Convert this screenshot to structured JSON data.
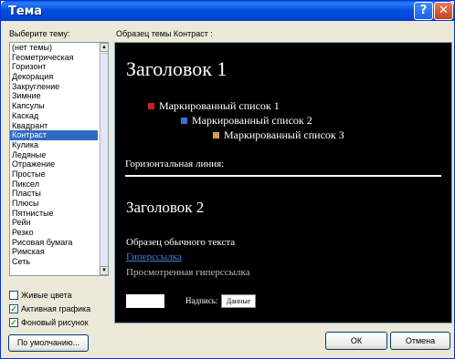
{
  "window": {
    "title": "Тема",
    "help_symbol": "?",
    "close_symbol": "✕"
  },
  "labels": {
    "choose_theme": "Выберите тему:",
    "sample": "Образец темы Контраст :"
  },
  "theme_list": {
    "items": [
      "(нет темы)",
      "Геометрическая",
      "Горизонт",
      "Декорация",
      "Закругление",
      "Зимние",
      "Капсулы",
      "Каскад",
      "Квадрант",
      "Контраст",
      "Кулика",
      "Ледяные",
      "Отражение",
      "Простые",
      "Пиксел",
      "Пласты",
      "Плюсы",
      "Пятнистые",
      "Рейн",
      "Резко",
      "Рисовая бумага",
      "Римская",
      "Сеть"
    ],
    "selected_index": 9
  },
  "checkboxes": [
    {
      "label": "Живые цвета",
      "checked": false
    },
    {
      "label": "Активная графика",
      "checked": true
    },
    {
      "label": "Фоновый рисунок",
      "checked": true
    }
  ],
  "buttons": {
    "default": "По умолчанию...",
    "ok": "ОК",
    "cancel": "Отмена"
  },
  "preview": {
    "heading1": "Заголовок 1",
    "bullets": [
      {
        "text": "Маркированный список 1",
        "color": "#C81E1E"
      },
      {
        "text": "Маркированный список 2",
        "color": "#3C6EDC"
      },
      {
        "text": "Маркированный список 3",
        "color": "#D2A03C"
      }
    ],
    "hr_label": "Горизонтальная линия:",
    "heading2": "Заголовок 2",
    "body_text": "Образец обычного текста",
    "hyperlink": "Гиперссылка",
    "visited_link": "Просмотренная гиперссылка",
    "label": "Надпись:",
    "input_value": "Данные"
  },
  "colors": {
    "titlebar": "#0050E0",
    "selection": "#316AC5",
    "preview_bg": "#000000"
  }
}
